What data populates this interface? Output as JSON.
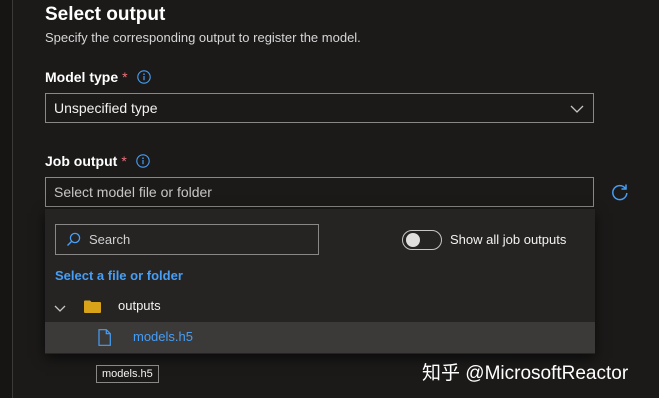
{
  "header": {
    "title": "Select output",
    "subtitle": "Specify the corresponding output to register the model."
  },
  "model_type": {
    "label": "Model type",
    "required_marker": "*",
    "value": "Unspecified type"
  },
  "job_output": {
    "label": "Job output",
    "required_marker": "*",
    "placeholder": "Select model file or folder"
  },
  "dropdown": {
    "search_placeholder": "Search",
    "toggle_label": "Show all job outputs",
    "toggle_on": false,
    "section_title": "Select a file or folder",
    "folder_name": "outputs",
    "file_name": "models.h5"
  },
  "tooltip": "models.h5",
  "watermark": "知乎 @MicrosoftReactor",
  "colors": {
    "accent": "#479ef5",
    "required": "#f1707b",
    "folder": "#d8a318",
    "background": "#1b1a19"
  }
}
